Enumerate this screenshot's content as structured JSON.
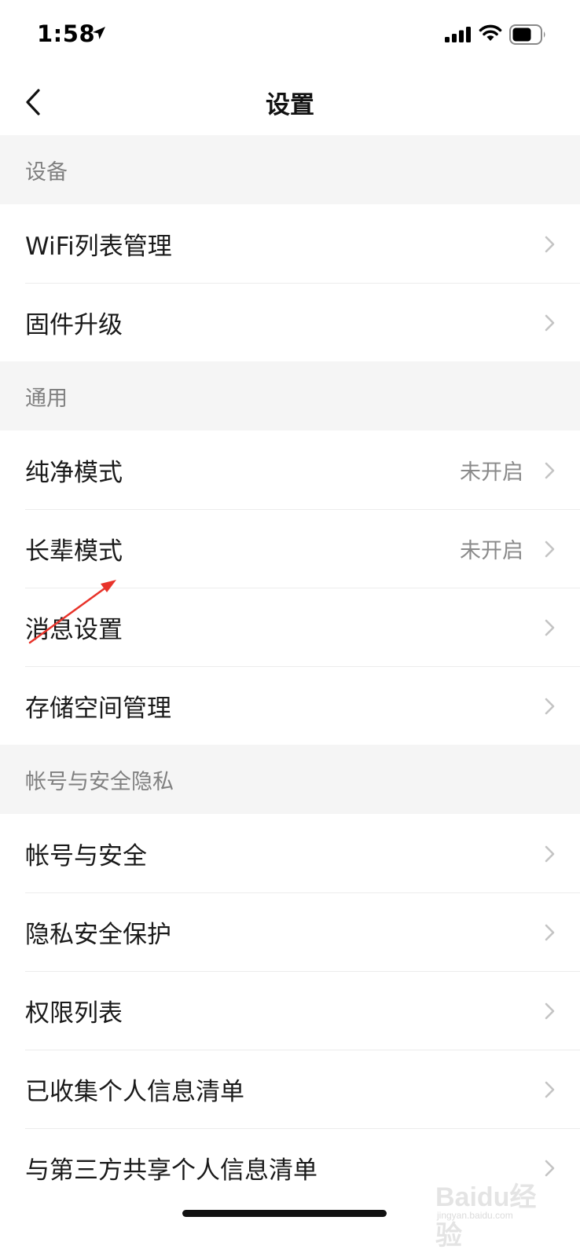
{
  "status_bar": {
    "time": "1:58"
  },
  "nav": {
    "title": "设置"
  },
  "sections": [
    {
      "header": "设备",
      "items": [
        {
          "label": "WiFi列表管理",
          "value": ""
        },
        {
          "label": "固件升级",
          "value": ""
        }
      ]
    },
    {
      "header": "通用",
      "items": [
        {
          "label": "纯净模式",
          "value": "未开启"
        },
        {
          "label": "长辈模式",
          "value": "未开启"
        },
        {
          "label": "消息设置",
          "value": ""
        },
        {
          "label": "存储空间管理",
          "value": ""
        }
      ]
    },
    {
      "header": "帐号与安全隐私",
      "items": [
        {
          "label": "帐号与安全",
          "value": ""
        },
        {
          "label": "隐私安全保护",
          "value": ""
        },
        {
          "label": "权限列表",
          "value": ""
        },
        {
          "label": "已收集个人信息清单",
          "value": ""
        },
        {
          "label": "与第三方共享个人信息清单",
          "value": ""
        }
      ]
    }
  ],
  "watermark": {
    "text": "Baidu经验",
    "sub": "jingyan.baidu.com"
  },
  "colors": {
    "annotation": "#e8332a",
    "chevron": "#c4c4c4",
    "section_bg": "#f5f5f5"
  }
}
